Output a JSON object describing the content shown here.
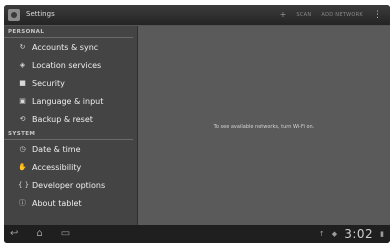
{
  "app": {
    "title": "Settings"
  },
  "actionbar": {
    "icons": {
      "add": "plus-icon",
      "overflow": "overflow-menu-icon"
    },
    "scan_label": "SCAN",
    "add_network_label": "ADD NETWORK"
  },
  "sections": [
    {
      "header": "PERSONAL",
      "items": [
        {
          "label": "Accounts & sync",
          "icon": "sync-icon"
        },
        {
          "label": "Location services",
          "icon": "location-icon"
        },
        {
          "label": "Security",
          "icon": "lock-icon"
        },
        {
          "label": "Language & input",
          "icon": "keyboard-icon"
        },
        {
          "label": "Backup & reset",
          "icon": "backup-icon"
        }
      ]
    },
    {
      "header": "SYSTEM",
      "items": [
        {
          "label": "Date & time",
          "icon": "clock-icon"
        },
        {
          "label": "Accessibility",
          "icon": "accessibility-icon"
        },
        {
          "label": "Developer options",
          "icon": "braces-icon"
        },
        {
          "label": "About tablet",
          "icon": "info-icon"
        }
      ]
    }
  ],
  "content": {
    "message": "To see available networks, turn Wi-Fi on."
  },
  "statusbar": {
    "time": "3:02"
  },
  "colors": {
    "panel": "#444444",
    "content": "#5a5a5a",
    "bar": "#1f1f1f"
  }
}
